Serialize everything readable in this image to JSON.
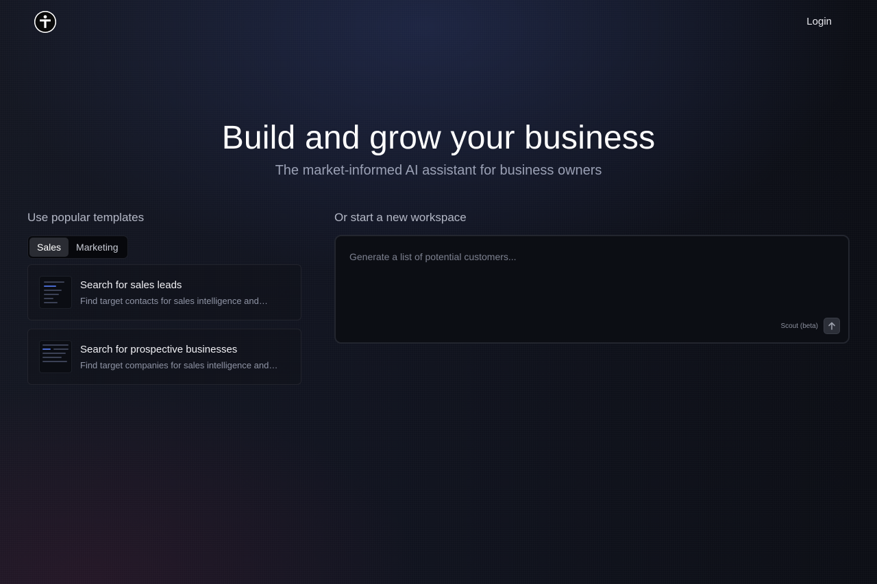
{
  "header": {
    "logo_icon": "accessibility-person-icon",
    "login_label": "Login"
  },
  "hero": {
    "title": "Build and grow your business",
    "subtitle": "The market-informed AI assistant for business owners"
  },
  "templates": {
    "label": "Use popular templates",
    "tabs": [
      {
        "label": "Sales",
        "active": true
      },
      {
        "label": "Marketing",
        "active": false
      }
    ],
    "cards": [
      {
        "title": "Search for sales leads",
        "description": "Find target contacts for sales intelligence and…"
      },
      {
        "title": "Search for prospective businesses",
        "description": "Find target companies for sales intelligence and…"
      }
    ]
  },
  "workspace": {
    "label": "Or start a new workspace",
    "placeholder": "Generate a list of potential customers...",
    "model_label": "Scout (beta)",
    "send_icon": "arrow-up-icon"
  },
  "colors": {
    "background": "#0d0f17",
    "text_primary": "#ffffff",
    "text_muted": "#9aa0b4",
    "tab_active": "#2a2c33"
  }
}
